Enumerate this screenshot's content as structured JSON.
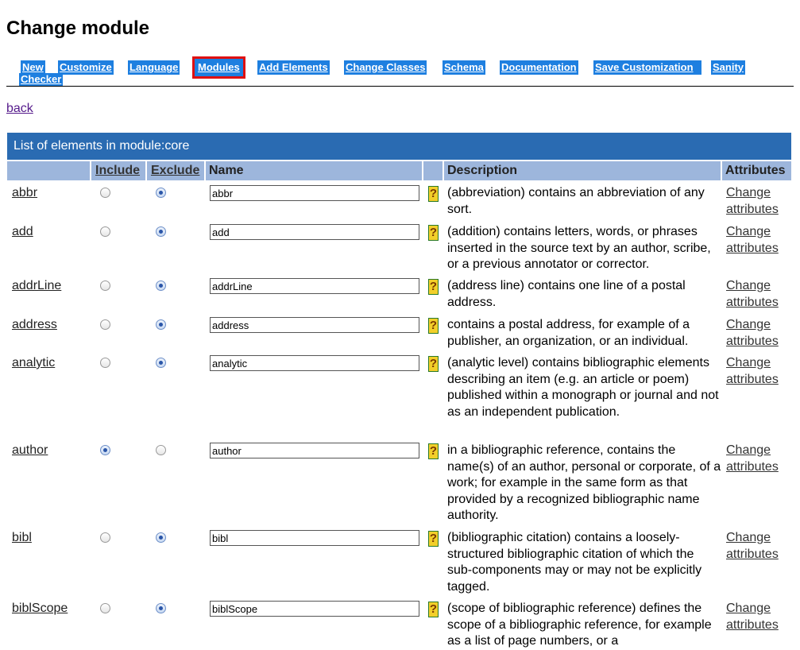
{
  "page_title": "Change module",
  "tabs": [
    {
      "label": "New",
      "active": false
    },
    {
      "label": "Customize",
      "active": false
    },
    {
      "label": "Language",
      "active": false
    },
    {
      "label": "Modules",
      "active": true
    },
    {
      "label": "Add Elements",
      "active": false
    },
    {
      "label": "Change Classes",
      "active": false
    },
    {
      "label": "Schema",
      "active": false
    },
    {
      "label": "Documentation",
      "active": false
    },
    {
      "label": "Save Customization",
      "active": false
    },
    {
      "label": "Sanity",
      "active": false
    }
  ],
  "tab_wrap_label": "Checker",
  "back_label": "back",
  "table": {
    "caption": "List of elements in module:core",
    "headers": {
      "include": "Include",
      "exclude": "Exclude",
      "name": "Name",
      "description": "Description",
      "attributes": "Attributes"
    },
    "rows": [
      {
        "element": "abbr",
        "selected": "exclude",
        "name_value": "abbr",
        "help": "?",
        "description": "(abbreviation) contains an abbreviation of any sort.",
        "attr_line1": "Change",
        "attr_line2": "attributes"
      },
      {
        "element": "add",
        "selected": "exclude",
        "name_value": "add",
        "help": "?",
        "description": "(addition) contains letters, words, or phrases inserted in the source text by an author, scribe, or a previous annotator or corrector.",
        "attr_line1": "Change",
        "attr_line2": "attributes"
      },
      {
        "element": "addrLine",
        "selected": "exclude",
        "name_value": "addrLine",
        "help": "?",
        "description": "(address line) contains one line of a postal address.",
        "attr_line1": "Change",
        "attr_line2": "attributes"
      },
      {
        "element": "address",
        "selected": "exclude",
        "name_value": "address",
        "help": "?",
        "description": "contains a postal address, for example of a publisher, an organization, or an individual.",
        "attr_line1": "Change",
        "attr_line2": "attributes"
      },
      {
        "element": "analytic",
        "selected": "exclude",
        "name_value": "analytic",
        "help": "?",
        "description": "(analytic level) contains bibliographic elements describing an item (e.g. an article or poem) published within a monograph or journal and not as an independent publication.",
        "attr_line1": "Change",
        "attr_line2": "attributes"
      },
      {
        "element": "author",
        "selected": "include",
        "name_value": "author",
        "help": "?",
        "description": "in a bibliographic reference, contains the name(s) of an author, personal or corporate, of a work; for example in the same form as that provided by a recognized bibliographic name authority.",
        "attr_line1": "Change",
        "attr_line2": "attributes"
      },
      {
        "element": "bibl",
        "selected": "exclude",
        "name_value": "bibl",
        "help": "?",
        "description": "(bibliographic citation) contains a loosely-structured bibliographic citation of which the sub-components may or may not be explicitly tagged.",
        "attr_line1": "Change",
        "attr_line2": "attributes"
      },
      {
        "element": "biblScope",
        "selected": "exclude",
        "name_value": "biblScope",
        "help": "?",
        "description": "(scope of bibliographic reference) defines the scope of a bibliographic reference, for example as a list of page numbers, or a",
        "attr_line1": "Change",
        "attr_line2": "attributes"
      }
    ]
  },
  "colors": {
    "tab_bg": "#1e7fe0",
    "active_tab_border": "#e01010",
    "caption_bg": "#2a6bb2",
    "header_bg": "#9db6dc",
    "help_icon_bg": "#f2cf2a"
  }
}
